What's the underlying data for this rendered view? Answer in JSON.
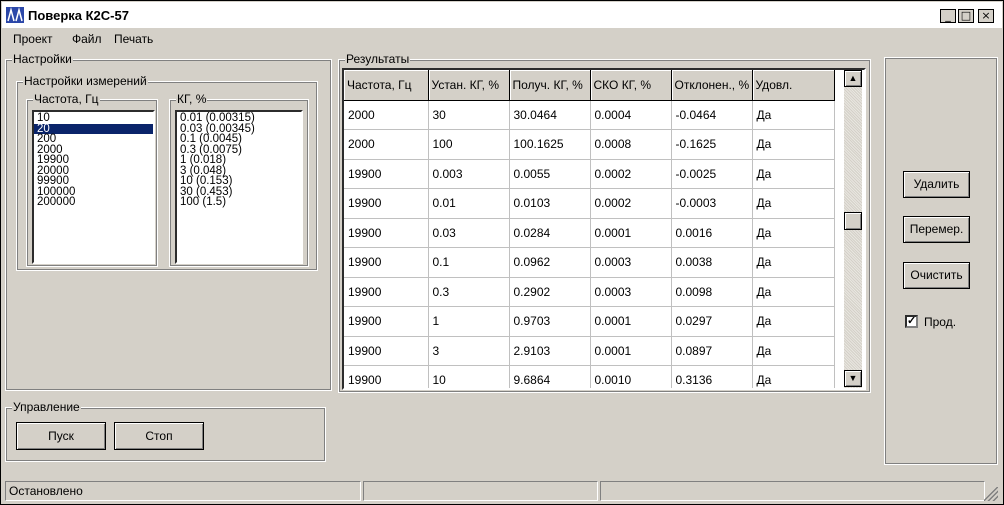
{
  "window": {
    "title": "Поверка К2С-57",
    "controls": [
      "_",
      "□",
      "×"
    ]
  },
  "menu": [
    "Проект",
    "Файл",
    "Печать"
  ],
  "settings": {
    "group_label": "Настройки",
    "measure_group_label": "Настройки измерений",
    "freq_label": "Частота, Гц",
    "freq_items": [
      "10",
      "20",
      "200",
      "2000",
      "19900",
      "20000",
      "99900",
      "100000",
      "200000"
    ],
    "freq_selected": "20",
    "kg_label": "КГ, %",
    "kg_items": [
      "0.01  (0.00315)",
      "0.03  (0.00345)",
      "0.1  (0.0045)",
      "0.3  (0.0075)",
      "1  (0.018)",
      "3  (0.048)",
      "10  (0.153)",
      "30  (0.453)",
      "100  (1.5)"
    ]
  },
  "control": {
    "group_label": "Управление",
    "start": "Пуск",
    "stop": "Стоп"
  },
  "results": {
    "group_label": "Результаты",
    "columns": [
      "Частота, Гц",
      "Устан. КГ, %",
      "Получ. КГ, %",
      "СКО КГ, %",
      "Отклонен., %",
      "Удовл."
    ],
    "rows": [
      [
        "2000",
        "30",
        "30.0464",
        "0.0004",
        "-0.0464",
        "Да"
      ],
      [
        "2000",
        "100",
        "100.1625",
        "0.0008",
        "-0.1625",
        "Да"
      ],
      [
        "19900",
        "0.003",
        "0.0055",
        "0.0002",
        "-0.0025",
        "Да"
      ],
      [
        "19900",
        "0.01",
        "0.0103",
        "0.0002",
        "-0.0003",
        "Да"
      ],
      [
        "19900",
        "0.03",
        "0.0284",
        "0.0001",
        "0.0016",
        "Да"
      ],
      [
        "19900",
        "0.1",
        "0.0962",
        "0.0003",
        "0.0038",
        "Да"
      ],
      [
        "19900",
        "0.3",
        "0.2902",
        "0.0003",
        "0.0098",
        "Да"
      ],
      [
        "19900",
        "1",
        "0.9703",
        "0.0001",
        "0.0297",
        "Да"
      ],
      [
        "19900",
        "3",
        "2.9103",
        "0.0001",
        "0.0897",
        "Да"
      ],
      [
        "19900",
        "10",
        "9.6864",
        "0.0010",
        "0.3136",
        "Да"
      ]
    ]
  },
  "actions": {
    "delete": "Удалить",
    "remeasure": "Перемер.",
    "clear": "Очистить",
    "continue_label": "Прод.",
    "continue_checked": true
  },
  "status": {
    "text": "Остановлено"
  },
  "colors": {
    "face": "#d4d0c8",
    "selection": "#0a246a"
  }
}
